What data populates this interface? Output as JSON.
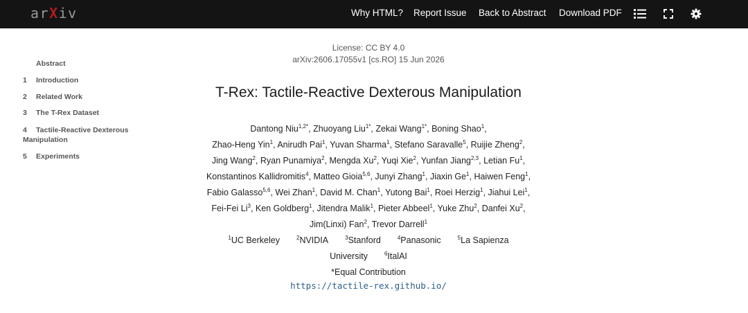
{
  "header": {
    "logo": {
      "pre": "ar",
      "mid": "X",
      "post": "iv"
    },
    "links": [
      "Why HTML?",
      "Report Issue",
      "Back to Abstract",
      "Download PDF"
    ],
    "icons": [
      "list-icon",
      "fullscreen-icon",
      "settings-icon"
    ]
  },
  "toc": [
    {
      "num": "",
      "label": "Abstract"
    },
    {
      "num": "1",
      "label": "Introduction"
    },
    {
      "num": "2",
      "label": "Related Work"
    },
    {
      "num": "3",
      "label": "The T-Rex Dataset"
    },
    {
      "num": "4",
      "label": "Tactile-Reactive Dexterous",
      "label2": "Manipulation"
    },
    {
      "num": "5",
      "label": "Experiments"
    }
  ],
  "paper": {
    "license": "License: CC BY 4.0",
    "arxiv_id": "arXiv:2606.17055v1 [cs.RO] 15 Jun 2026",
    "title": "T-Rex: Tactile-Reactive Dexterous Manipulation",
    "author_lines": [
      [
        [
          "Dantong Niu",
          "1,2*"
        ],
        [
          "Zhuoyang Liu",
          "1*"
        ],
        [
          "Zekai Wang",
          "1*"
        ],
        [
          "Boning Shao",
          "1"
        ]
      ],
      [
        [
          "Zhao-Heng Yin",
          "1"
        ],
        [
          "Anirudh Pai",
          "1"
        ],
        [
          "Yuvan Sharma",
          "1"
        ],
        [
          "Stefano Saravalle",
          "5"
        ],
        [
          "Ruijie Zheng",
          "2"
        ]
      ],
      [
        [
          "Jing Wang",
          "2"
        ],
        [
          "Ryan Punamiya",
          "2"
        ],
        [
          "Mengda Xu",
          "2"
        ],
        [
          "Yuqi Xie",
          "2"
        ],
        [
          "Yunfan Jiang",
          "2,3"
        ],
        [
          "Letian Fu",
          "1"
        ]
      ],
      [
        [
          "Konstantinos Kallidromitis",
          "4"
        ],
        [
          "Matteo Gioia",
          "5,6"
        ],
        [
          "Junyi Zhang",
          "1"
        ],
        [
          "Jiaxin Ge",
          "1"
        ],
        [
          "Haiwen Feng",
          "1"
        ]
      ],
      [
        [
          "Fabio Galasso",
          "5,6"
        ],
        [
          "Wei Zhan",
          "1"
        ],
        [
          "David M. Chan",
          "1"
        ],
        [
          "Yutong Bai",
          "1"
        ],
        [
          "Roei Herzig",
          "1"
        ],
        [
          "Jiahui Lei",
          "1"
        ]
      ],
      [
        [
          "Fei-Fei Li",
          "3"
        ],
        [
          "Ken Goldberg",
          "1"
        ],
        [
          "Jitendra Malik",
          "1"
        ],
        [
          "Pieter Abbeel",
          "1"
        ],
        [
          "Yuke Zhu",
          "2"
        ],
        [
          "Danfei Xu",
          "2"
        ]
      ],
      [
        [
          "Jim(Linxi) Fan",
          "2"
        ],
        [
          "Trevor Darrell",
          "1"
        ]
      ]
    ],
    "affiliations_line1": [
      [
        "1",
        "UC Berkeley"
      ],
      [
        "2",
        "NVIDIA"
      ],
      [
        "3",
        "Stanford"
      ],
      [
        "4",
        "Panasonic"
      ],
      [
        "5",
        "La Sapienza"
      ]
    ],
    "affiliations_line2": [
      [
        "",
        "University"
      ],
      [
        "6",
        "ItalAI"
      ]
    ],
    "equal_contribution": "*Equal Contribution",
    "url": "https://tactile-rex.github.io/"
  }
}
